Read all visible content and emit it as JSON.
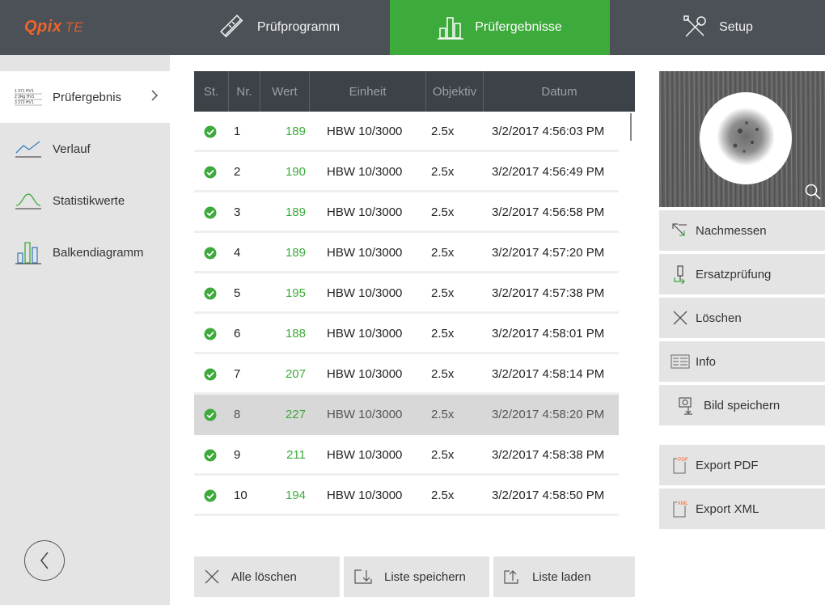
{
  "app": {
    "logo": "Qpix",
    "logo_suffix": "TE"
  },
  "nav": {
    "tabs": [
      {
        "label": "Prüfprogramm",
        "icon": "ruler-pencil-icon"
      },
      {
        "label": "Prüfergebnisse",
        "icon": "bar-chart-icon",
        "active": true
      },
      {
        "label": "Setup",
        "icon": "tools-icon"
      }
    ]
  },
  "sidebar": {
    "items": [
      {
        "label": "Prüfergebnis",
        "icon": "result-list-icon",
        "active": true
      },
      {
        "label": "Verlauf",
        "icon": "line-chart-icon"
      },
      {
        "label": "Statistikwerte",
        "icon": "bell-curve-icon"
      },
      {
        "label": "Balkendiagramm",
        "icon": "bar-chart-icon"
      }
    ],
    "result_icon_text": [
      "1 371 HV1",
      "2 3Rg HV1",
      "3 373 HV1"
    ]
  },
  "table": {
    "columns": [
      "St.",
      "Nr.",
      "Wert",
      "Einheit",
      "Objektiv",
      "Datum"
    ],
    "rows": [
      {
        "nr": "1",
        "wert": "189",
        "einheit": "HBW 10/3000",
        "objektiv": "2.5x",
        "datum": "3/2/2017 4:56:03 PM"
      },
      {
        "nr": "2",
        "wert": "190",
        "einheit": "HBW 10/3000",
        "objektiv": "2.5x",
        "datum": "3/2/2017 4:56:49 PM"
      },
      {
        "nr": "3",
        "wert": "189",
        "einheit": "HBW 10/3000",
        "objektiv": "2.5x",
        "datum": "3/2/2017 4:56:58 PM"
      },
      {
        "nr": "4",
        "wert": "189",
        "einheit": "HBW 10/3000",
        "objektiv": "2.5x",
        "datum": "3/2/2017 4:57:20 PM"
      },
      {
        "nr": "5",
        "wert": "195",
        "einheit": "HBW 10/3000",
        "objektiv": "2.5x",
        "datum": "3/2/2017 4:57:38 PM"
      },
      {
        "nr": "6",
        "wert": "188",
        "einheit": "HBW 10/3000",
        "objektiv": "2.5x",
        "datum": "3/2/2017 4:58:01 PM"
      },
      {
        "nr": "7",
        "wert": "207",
        "einheit": "HBW 10/3000",
        "objektiv": "2.5x",
        "datum": "3/2/2017 4:58:14 PM"
      },
      {
        "nr": "8",
        "wert": "227",
        "einheit": "HBW 10/3000",
        "objektiv": "2.5x",
        "datum": "3/2/2017 4:58:20 PM",
        "selected": true
      },
      {
        "nr": "9",
        "wert": "211",
        "einheit": "HBW 10/3000",
        "objektiv": "2.5x",
        "datum": "3/2/2017 4:58:38 PM"
      },
      {
        "nr": "10",
        "wert": "194",
        "einheit": "HBW 10/3000",
        "objektiv": "2.5x",
        "datum": "3/2/2017 4:58:50 PM"
      }
    ]
  },
  "bottom_buttons": {
    "alle_loeschen": "Alle löschen",
    "liste_speichern": "Liste speichern",
    "liste_laden": "Liste laden"
  },
  "right_panel": {
    "buttons": [
      {
        "label": "Nachmessen",
        "icon": "remeasure-icon"
      },
      {
        "label": "Ersatzprüfung",
        "icon": "replacement-test-icon"
      },
      {
        "label": "Löschen",
        "icon": "close-icon"
      },
      {
        "label": "Info",
        "icon": "info-doc-icon"
      },
      {
        "label": "Bild speichern",
        "icon": "save-image-icon"
      },
      {
        "label": "Export PDF",
        "icon": "pdf-icon",
        "icon_text": "PDF"
      },
      {
        "label": "Export XML",
        "icon": "xml-icon",
        "icon_text": "XML"
      }
    ]
  },
  "colors": {
    "accent_green": "#3daa3c",
    "topbar": "#4b5157",
    "table_header": "#3c4248",
    "sidebar_bg": "#e4e4e4",
    "logo_orange": "#f0642a"
  }
}
